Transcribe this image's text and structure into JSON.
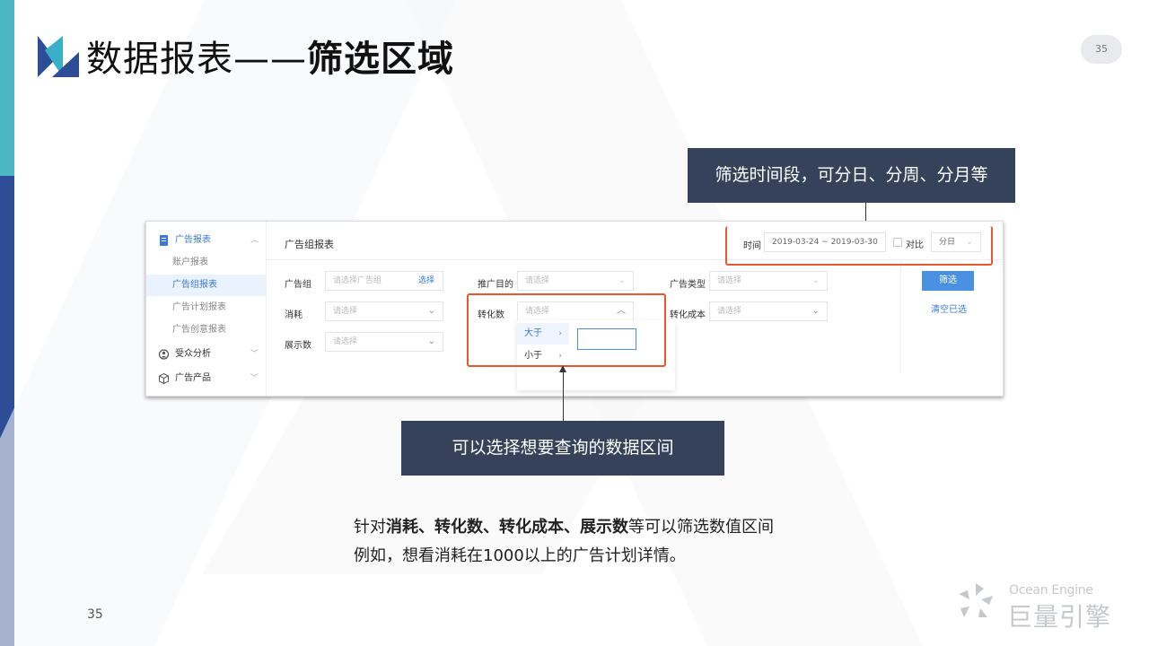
{
  "slide": {
    "title_normal": "数据报表——",
    "title_bold": "筛选区域",
    "page_badge": "35",
    "page_number": "35"
  },
  "callouts": {
    "top": "筛选时间段，可分日、分周、分月等",
    "bottom": "可以选择想要查询的数据区间"
  },
  "app": {
    "sidebar": {
      "report_header": "广告报表",
      "sub_items": [
        "账户报表",
        "广告组报表",
        "广告计划报表",
        "广告创意报表"
      ],
      "active_index": 1,
      "audience": "受众分析",
      "product": "广告产品"
    },
    "main_title": "广告组报表",
    "time": {
      "label": "时间",
      "range": "2019-03-24 ~ 2019-03-30",
      "compare_label": "对比",
      "granularity": "分日"
    },
    "filters": {
      "ad_group_label": "广告组",
      "ad_group_placeholder": "请选择广告组",
      "ad_group_link": "选择",
      "purpose_label": "推广目的",
      "purpose_placeholder": "请选择",
      "ad_type_label": "广告类型",
      "ad_type_placeholder": "请选择",
      "cost_label": "消耗",
      "cost_placeholder": "请选择",
      "conversion_label": "转化数",
      "conversion_placeholder": "请选择",
      "conv_cost_label": "转化成本",
      "conv_cost_placeholder": "请选择",
      "impression_label": "展示数",
      "impression_placeholder": "请选择"
    },
    "dropdown": {
      "greater": "大于",
      "less": "小于"
    },
    "buttons": {
      "filter": "筛选",
      "clear": "清空已选"
    }
  },
  "description": {
    "line1_prefix": "针对",
    "line1_bold": "消耗、转化数、转化成本、展示数",
    "line1_suffix": "等可以筛选数值区间",
    "line2": "例如，想看消耗在1000以上的广告计划详情。"
  },
  "brand": {
    "english": "Ocean Engine",
    "chinese": "巨量引擎"
  },
  "colors": {
    "accent_blue": "#3a7bd5",
    "highlight_orange": "#e8572e",
    "callout_bg": "#36425a",
    "left_bar_blue": "#2d4e96",
    "left_bar_teal": "#4db6c4"
  }
}
